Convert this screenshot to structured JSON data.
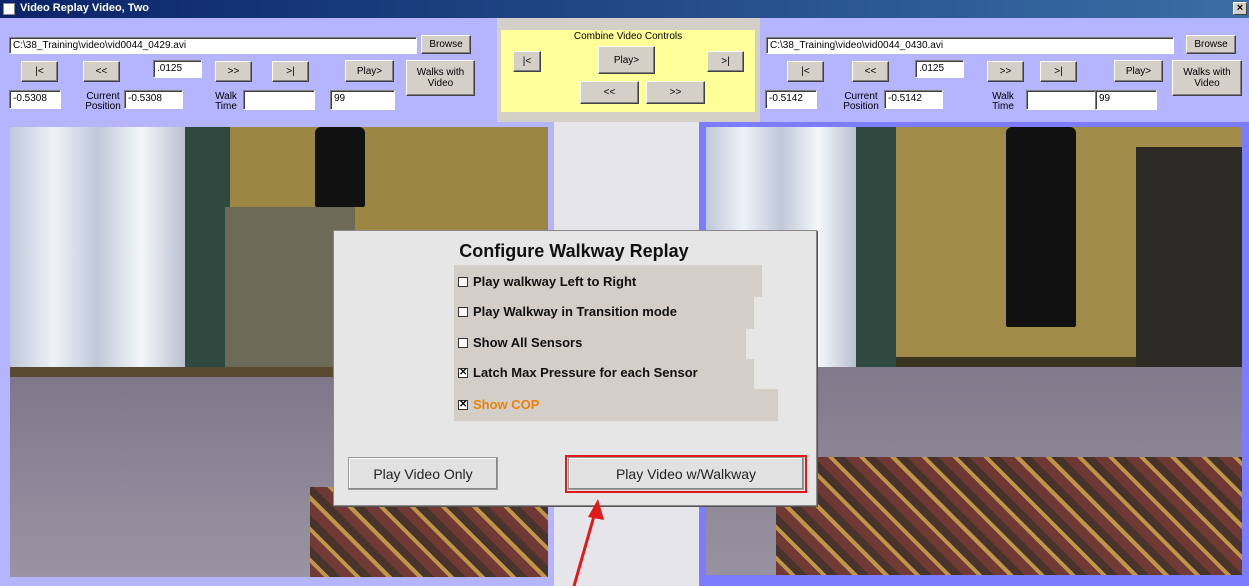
{
  "window": {
    "title": "Video Replay Video, Two",
    "close_label": "×"
  },
  "left_panel": {
    "file_path": "C:\\38_Training\\video\\vid0044_0429.avi",
    "browse_label": "Browse",
    "btn_start": "|<",
    "btn_back": "<<",
    "step_value": ".0125",
    "btn_fwd": ">>",
    "btn_end": ">|",
    "play_label": "Play>",
    "walks_label": "Walks with Video",
    "start_value": "-0.5308",
    "current_label": "Current Position",
    "current_value": "-0.5308",
    "walk_time_label": "Walk Time",
    "walk_time_value": "",
    "count_value": "99"
  },
  "combine_panel": {
    "title": "Combine Video Controls",
    "btn_start": "|<",
    "play_label": "Play>",
    "btn_end": ">|",
    "btn_back": "<<",
    "btn_fwd": ">>"
  },
  "right_panel": {
    "file_path": "C:\\38_Training\\video\\vid0044_0430.avi",
    "browse_label": "Browse",
    "btn_start": "|<",
    "btn_back": "<<",
    "step_value": ".0125",
    "btn_fwd": ">>",
    "btn_end": ">|",
    "play_label": "Play>",
    "walks_label": "Walks with Video",
    "start_value": "-0.5142",
    "current_label": "Current Position",
    "current_value": "-0.5142",
    "walk_time_label": "Walk Time",
    "walk_time_value": "",
    "count_value": "99"
  },
  "dialog": {
    "title": "Configure Walkway Replay",
    "options": [
      {
        "label": "Play walkway Left to Right",
        "checked": false
      },
      {
        "label": "Play Walkway in Transition mode",
        "checked": false
      },
      {
        "label": "Show All Sensors",
        "checked": false
      },
      {
        "label": "Latch Max Pressure for each Sensor",
        "checked": true
      },
      {
        "label": "Show COP",
        "checked": true,
        "color": "#e8820c"
      }
    ],
    "play_only_label": "Play Video Only",
    "play_walkway_label": "Play Video w/Walkway",
    "highlight_color": "#e01a1a"
  },
  "colors": {
    "panel_blue": "#b4b4ff",
    "panel_yellow": "#ffff99",
    "annotation_red": "#e01a1a"
  }
}
